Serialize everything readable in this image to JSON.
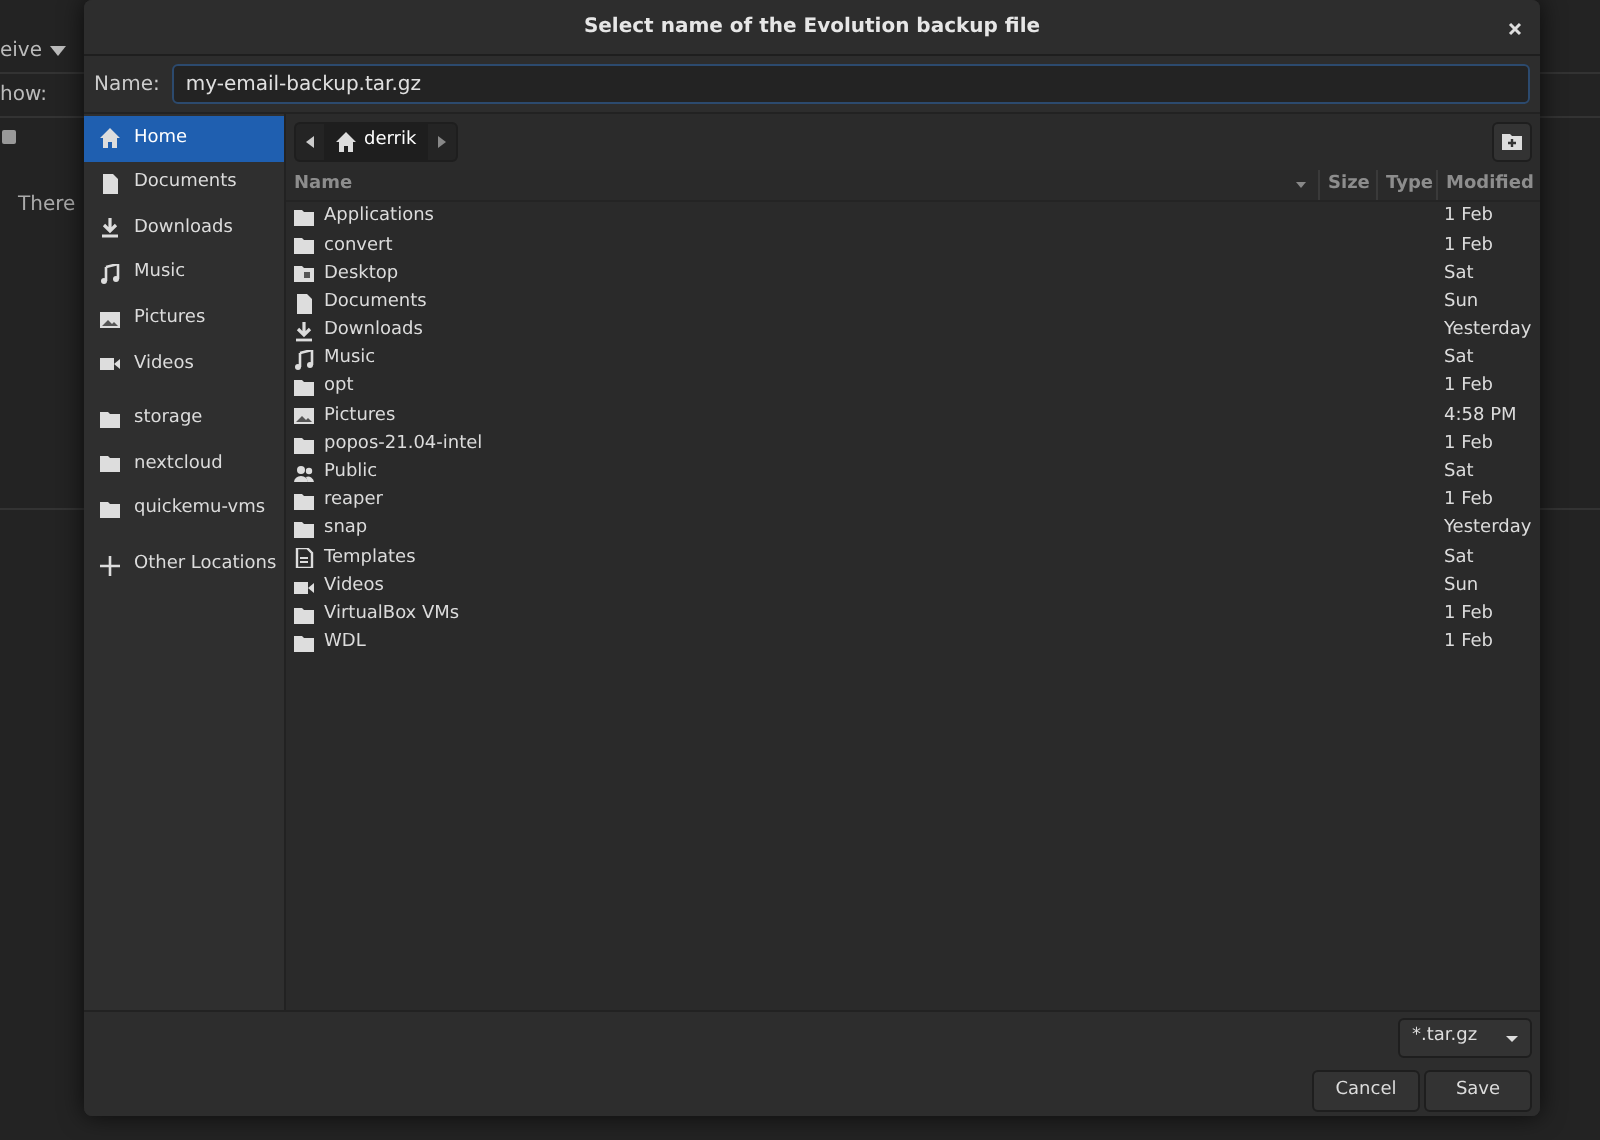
{
  "background_app": {
    "dropdown": "eive",
    "show_label": "how:",
    "message": "There"
  },
  "dialog": {
    "title": "Select name of the Evolution backup file",
    "name_label": "Name:",
    "name_value": "my-email-backup.tar.gz",
    "sidebar": [
      {
        "label": "Home",
        "kind": "home",
        "selected": true
      },
      {
        "label": "Documents",
        "kind": "document",
        "selected": false
      },
      {
        "label": "Downloads",
        "kind": "download",
        "selected": false
      },
      {
        "label": "Music",
        "kind": "music",
        "selected": false
      },
      {
        "label": "Pictures",
        "kind": "pictures",
        "selected": false
      },
      {
        "label": "Videos",
        "kind": "videos",
        "selected": false
      },
      {
        "label": "storage",
        "kind": "folder",
        "selected": false
      },
      {
        "label": "nextcloud",
        "kind": "folder",
        "selected": false
      },
      {
        "label": "quickemu-vms",
        "kind": "folder",
        "selected": false
      },
      {
        "label": "Other Locations",
        "kind": "plus",
        "selected": false
      }
    ],
    "path": [
      {
        "label": "derrik",
        "selected": true
      }
    ],
    "columns": [
      "Name",
      "Size",
      "Type",
      "Modified"
    ],
    "files": [
      {
        "name": "Applications",
        "kind": "folder",
        "modified": "1 Feb"
      },
      {
        "name": "convert",
        "kind": "folder",
        "modified": "1 Feb"
      },
      {
        "name": "Desktop",
        "kind": "desktop",
        "modified": "Sat"
      },
      {
        "name": "Documents",
        "kind": "document",
        "modified": "Sun"
      },
      {
        "name": "Downloads",
        "kind": "download",
        "modified": "Yesterday"
      },
      {
        "name": "Music",
        "kind": "music",
        "modified": "Sat"
      },
      {
        "name": "opt",
        "kind": "folder",
        "modified": "1 Feb"
      },
      {
        "name": "Pictures",
        "kind": "pictures",
        "modified": "4:58 PM"
      },
      {
        "name": "popos-21.04-intel",
        "kind": "folder",
        "modified": "1 Feb"
      },
      {
        "name": "Public",
        "kind": "public",
        "modified": "Sat"
      },
      {
        "name": "reaper",
        "kind": "folder",
        "modified": "1 Feb"
      },
      {
        "name": "snap",
        "kind": "folder",
        "modified": "Yesterday"
      },
      {
        "name": "Templates",
        "kind": "templates",
        "modified": "Sat"
      },
      {
        "name": "Videos",
        "kind": "videos",
        "modified": "Sun"
      },
      {
        "name": "VirtualBox VMs",
        "kind": "folder",
        "modified": "1 Feb"
      },
      {
        "name": "WDL",
        "kind": "folder",
        "modified": "1 Feb"
      }
    ],
    "filter": "*.tar.gz",
    "buttons": [
      "Cancel",
      "Save"
    ]
  }
}
